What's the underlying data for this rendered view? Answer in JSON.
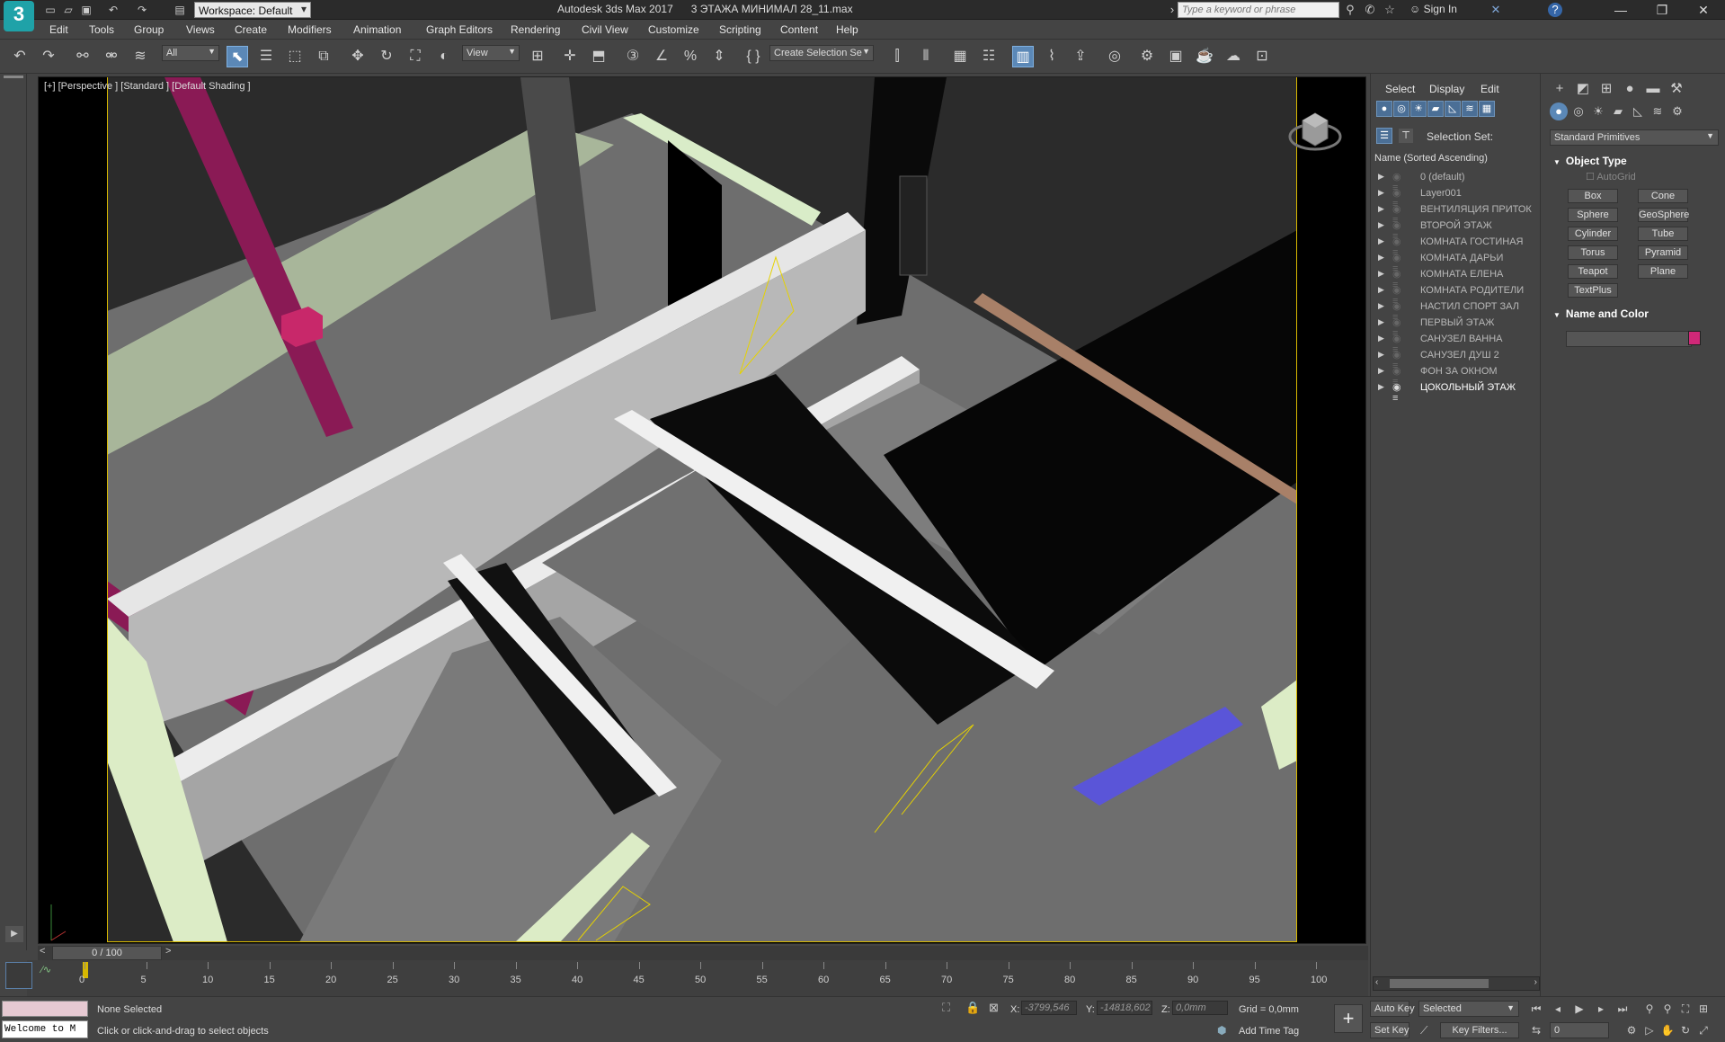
{
  "titlebar": {
    "workspace": "Workspace: Default",
    "title": "Autodesk 3ds Max 2017      3 ЭТАЖА МИНИМАЛ 28_11.max",
    "search_placeholder": "Type a keyword or phrase",
    "sign_in": "Sign In"
  },
  "menu": [
    "Edit",
    "Tools",
    "Group",
    "Views",
    "Create",
    "Modifiers",
    "Animation",
    "Graph Editors",
    "Rendering",
    "Civil View",
    "Customize",
    "Scripting",
    "Content",
    "Help"
  ],
  "toolbar": {
    "filter": "All",
    "ref_coord": "View",
    "selection_set": "Create Selection Se"
  },
  "viewport": {
    "label": "[+] [Perspective ] [Standard ] [Default Shading ]"
  },
  "scene_explorer": {
    "tabs": [
      "Select",
      "Display",
      "Edit"
    ],
    "selection_set_label": "Selection Set:",
    "column_header": "Name (Sorted Ascending)",
    "layers": [
      "0 (default)",
      "Layer001",
      "ВЕНТИЛЯЦИЯ ПРИТОК",
      "ВТОРОЙ ЭТАЖ",
      "КОМНАТА ГОСТИНАЯ",
      "КОМНАТА ДАРЬИ",
      "КОМНАТА ЕЛЕНА",
      "КОМНАТА РОДИТЕЛИ",
      "НАСТИЛ СПОРТ ЗАЛ",
      "ПЕРВЫЙ ЭТАЖ",
      "САНУЗЕЛ ВАННА",
      "САНУЗЕЛ ДУШ 2",
      "ФОН ЗА ОКНОМ",
      "ЦОКОЛЬНЫЙ ЭТАЖ"
    ],
    "current_layer": "ЦОКОЛЬНЫЙ ЭТАЖ"
  },
  "command_panel": {
    "category": "Standard Primitives",
    "object_type_header": "Object Type",
    "autogrid": "AutoGrid",
    "primitives": [
      "Box",
      "Cone",
      "Sphere",
      "GeoSphere",
      "Cylinder",
      "Tube",
      "Torus",
      "Pyramid",
      "Teapot",
      "Plane",
      "TextPlus"
    ],
    "name_color_header": "Name and Color",
    "object_color": "#d02878"
  },
  "timeline": {
    "frame_display": "0 / 100",
    "ticks": [
      "0",
      "5",
      "10",
      "15",
      "20",
      "25",
      "30",
      "35",
      "40",
      "45",
      "50",
      "55",
      "60",
      "65",
      "70",
      "75",
      "80",
      "85",
      "90",
      "95",
      "100"
    ]
  },
  "status": {
    "selection": "None Selected",
    "prompt": "Click or click-and-drag to select objects",
    "maxscript": "Welcome to M",
    "x_label": "X:",
    "x_value": "-3799,546",
    "y_label": "Y:",
    "y_value": "-14818,602",
    "z_label": "Z:",
    "z_value": "0,0mm",
    "grid": "Grid = 0,0mm",
    "add_time_tag": "Add Time Tag",
    "auto_key": "Auto Key",
    "set_key": "Set Key",
    "key_mode": "Selected",
    "key_filters": "Key Filters...",
    "current_frame": "0"
  },
  "colors": {
    "accent": "#5b88b7",
    "safe_frame": "#d8b800",
    "magenta_beam": "#8a1a55"
  }
}
